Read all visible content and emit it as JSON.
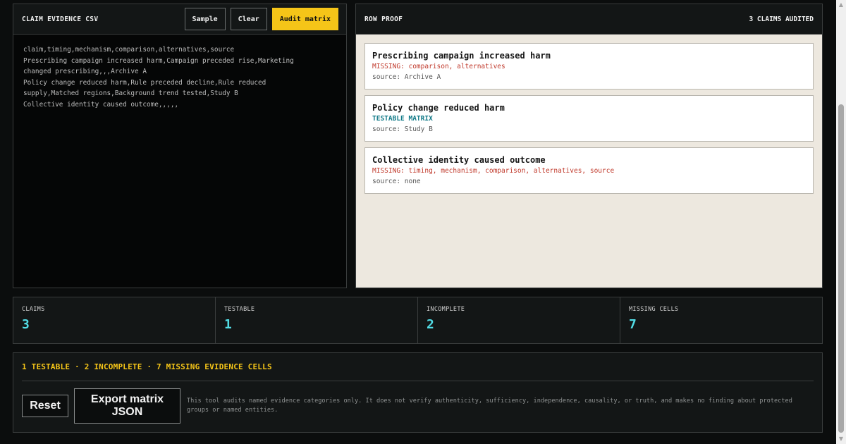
{
  "csv_panel": {
    "title": "CLAIM EVIDENCE CSV",
    "buttons": {
      "sample": "Sample",
      "clear": "Clear",
      "audit": "Audit matrix"
    },
    "text": "claim,timing,mechanism,comparison,alternatives,source\nPrescribing campaign increased harm,Campaign preceded rise,Marketing changed prescribing,,,Archive A\nPolicy change reduced harm,Rule preceded decline,Rule reduced supply,Matched regions,Background trend tested,Study B\nCollective identity caused outcome,,,,,"
  },
  "proof_panel": {
    "title": "ROW PROOF",
    "audited": "3 CLAIMS AUDITED",
    "cards": [
      {
        "title": "Prescribing campaign increased harm",
        "status": "MISSING: comparison, alternatives",
        "status_type": "missing",
        "source": "source: Archive A"
      },
      {
        "title": "Policy change reduced harm",
        "status": "TESTABLE MATRIX",
        "status_type": "ok",
        "source": "source: Study B"
      },
      {
        "title": "Collective identity caused outcome",
        "status": "MISSING: timing, mechanism, comparison, alternatives, source",
        "status_type": "missing",
        "source": "source: none"
      }
    ]
  },
  "stats": [
    {
      "label": "CLAIMS",
      "value": "3"
    },
    {
      "label": "TESTABLE",
      "value": "1"
    },
    {
      "label": "INCOMPLETE",
      "value": "2"
    },
    {
      "label": "MISSING CELLS",
      "value": "7"
    }
  ],
  "summary": {
    "line": "1 TESTABLE · 2 INCOMPLETE · 7 MISSING EVIDENCE CELLS",
    "reset_label": "Reset",
    "export_label": "Export matrix JSON",
    "disclaimer": "This tool audits named evidence categories only. It does not verify authenticity, sufficiency, independence, causality, or truth, and makes no finding about protected groups or named entities."
  },
  "colors": {
    "accent": "#f5c518",
    "stat_value": "#52dde6",
    "missing": "#c0392b",
    "testable": "#127a88"
  },
  "icons": {
    "scroll_up": "triangle-up-icon",
    "scroll_down": "triangle-down-icon"
  }
}
